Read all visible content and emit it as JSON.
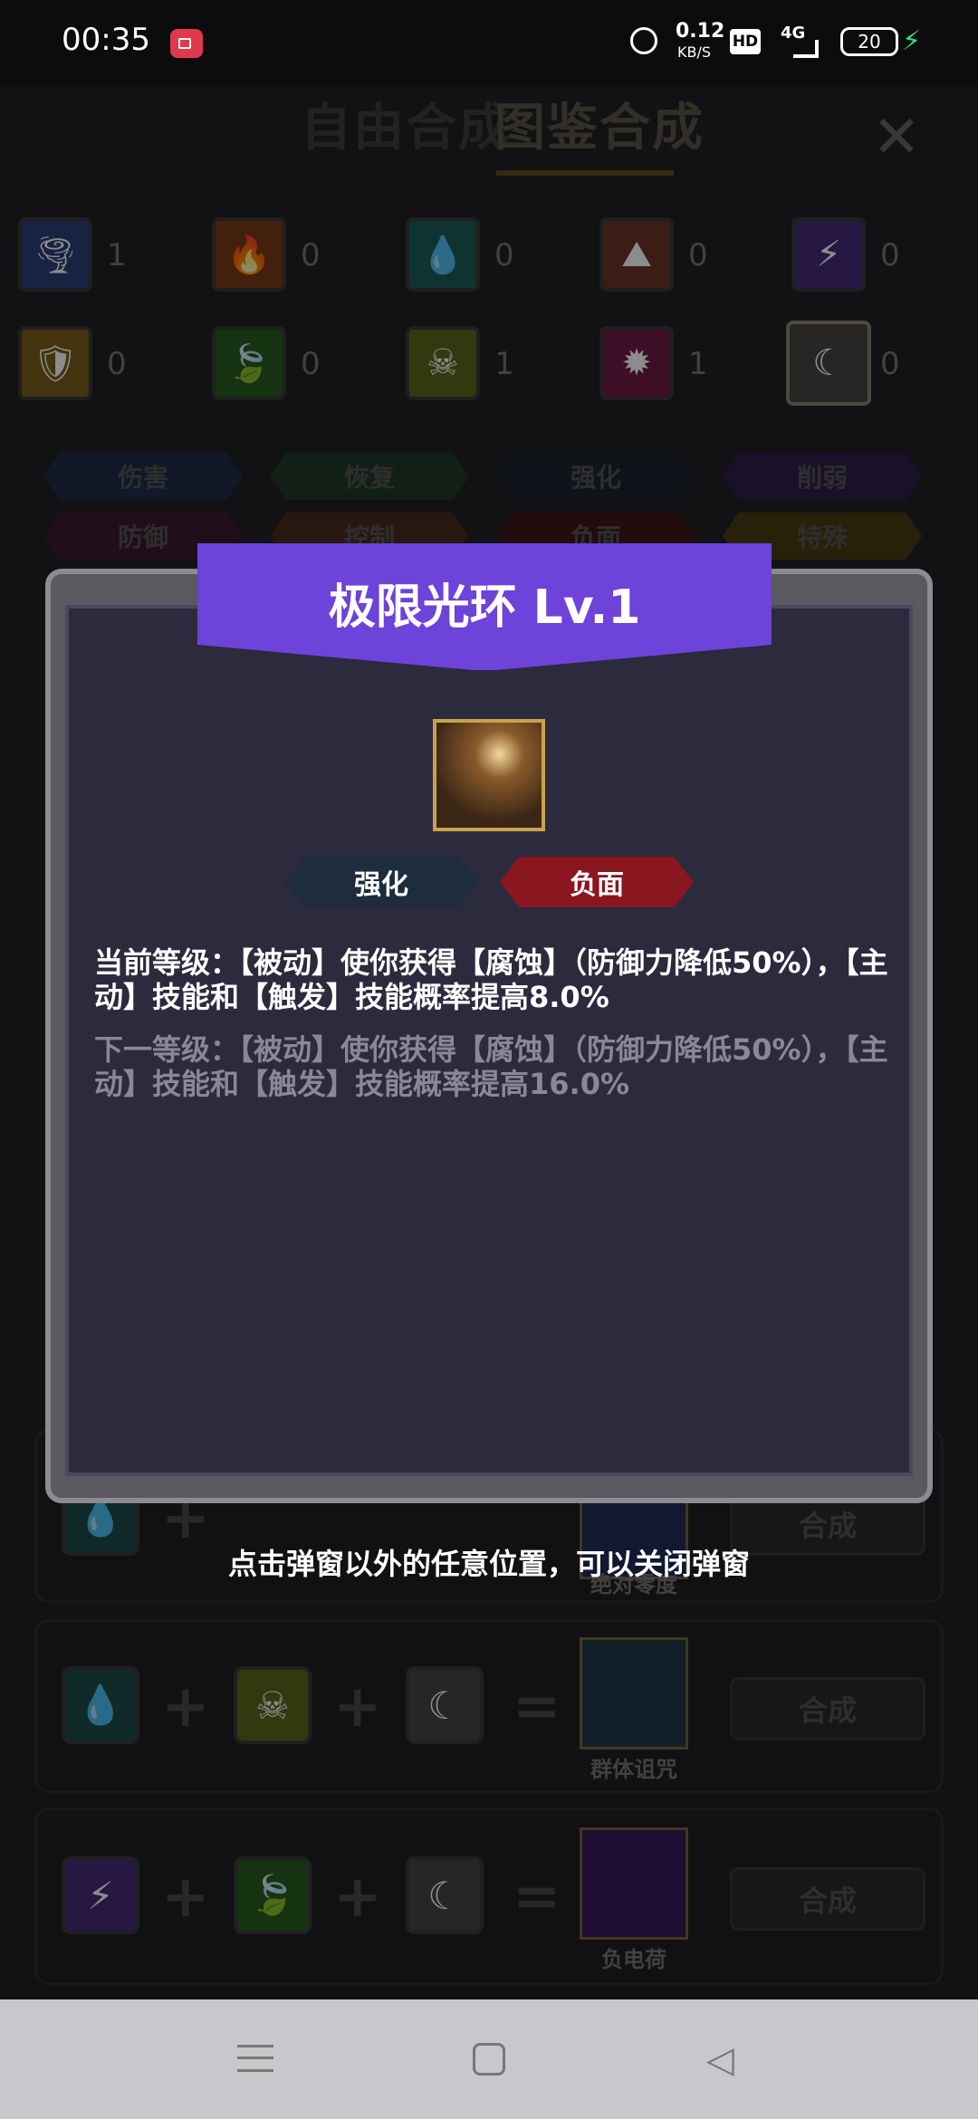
{
  "status_bar": {
    "time": "00:35",
    "net_speed": "0.12",
    "net_unit": "KB/S",
    "hd": "HD",
    "signal": "4G",
    "battery": "20"
  },
  "tabs": {
    "free": "自由合成",
    "atlas": "图鉴合成"
  },
  "elements": [
    {
      "icon": "tornado-icon",
      "count": "1",
      "color": "#3d5fc4"
    },
    {
      "icon": "fire-icon",
      "count": "0",
      "color": "#d0571f"
    },
    {
      "icon": "water-drop-icon",
      "count": "0",
      "color": "#1fa39a"
    },
    {
      "icon": "rock-icon",
      "count": "0",
      "color": "#b0543d"
    },
    {
      "icon": "lightning-icon",
      "count": "0",
      "color": "#6b3cc4"
    },
    {
      "icon": "shield-icon",
      "count": "0",
      "color": "#d8a22a"
    },
    {
      "icon": "leaf-icon",
      "count": "0",
      "color": "#3e9b2f"
    },
    {
      "icon": "skull-icon",
      "count": "1",
      "color": "#8fb02c"
    },
    {
      "icon": "sun-icon",
      "count": "1",
      "color": "#c22a6e"
    },
    {
      "icon": "moon-icon",
      "count": "0",
      "color": "#6a6662"
    }
  ],
  "categories": [
    "伤害",
    "恢复",
    "强化",
    "削弱",
    "防御",
    "控制",
    "负面",
    "特殊"
  ],
  "recipes": [
    {
      "result": "绝对零度",
      "button": "合成"
    },
    {
      "result": "群体诅咒",
      "button": "合成"
    },
    {
      "result": "负电荷",
      "button": "合成"
    }
  ],
  "modal": {
    "title": "极限光环 Lv.1",
    "tags": [
      "强化",
      "负面"
    ],
    "current": "当前等级：【被动】使你获得【腐蚀】（防御力降低50%），【主动】技能和【触发】技能概率提高8.0%",
    "next": "下一等级：【被动】使你获得【腐蚀】（防御力降低50%），【主动】技能和【触发】技能概率提高16.0%",
    "hint": "点击弹窗以外的任意位置，可以关闭弹窗"
  }
}
